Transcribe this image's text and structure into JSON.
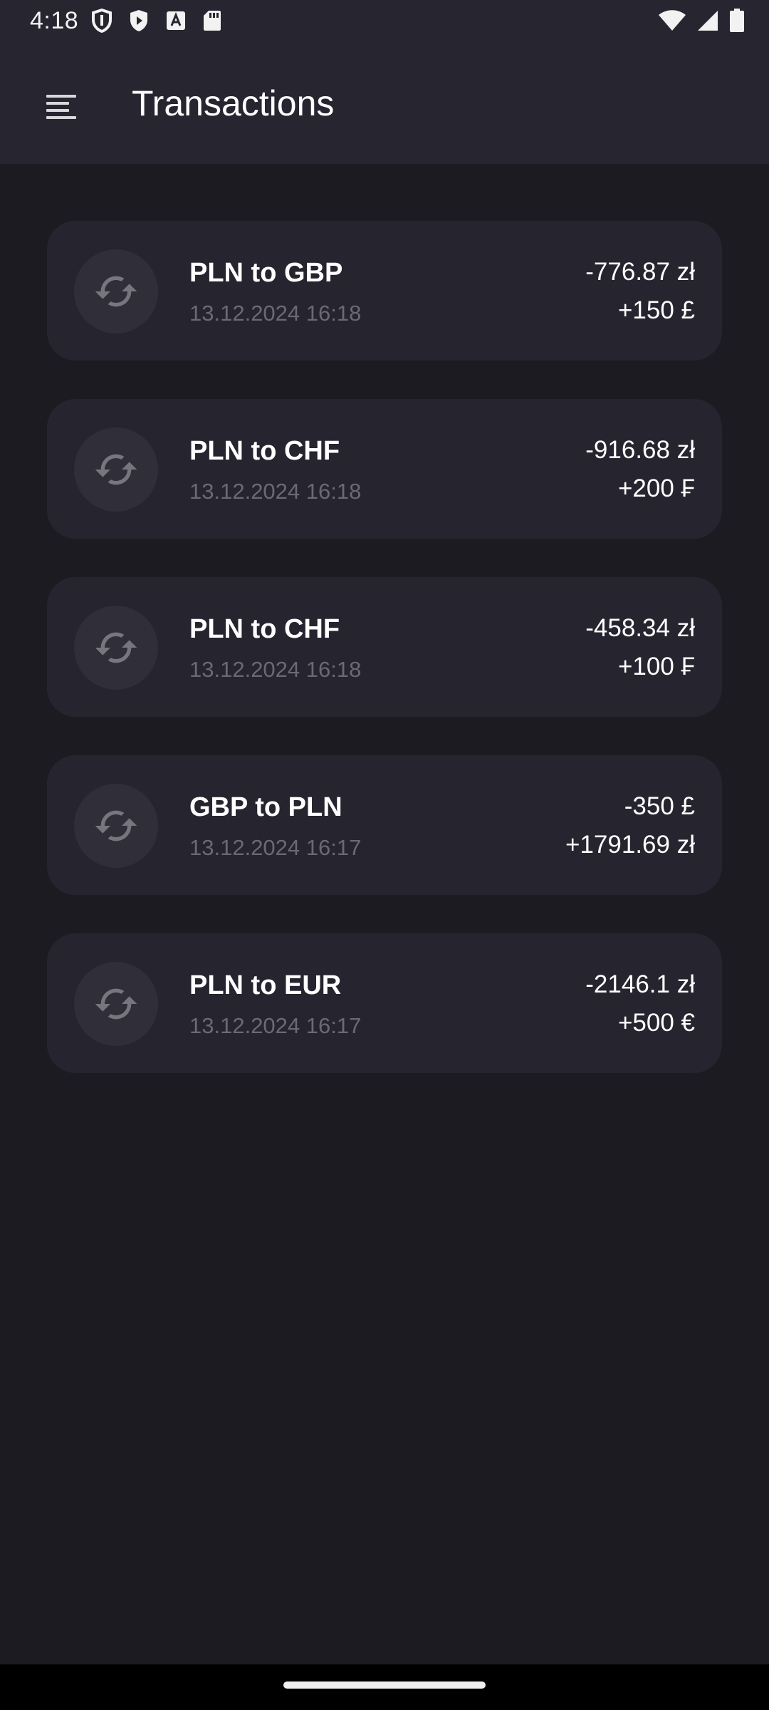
{
  "status_bar": {
    "time": "4:18",
    "left_icons": [
      "shield-icon",
      "play-protect-icon",
      "font-a-icon",
      "sd-card-icon"
    ],
    "right_icons": [
      "wifi-icon",
      "cellular-signal-icon",
      "battery-icon"
    ]
  },
  "app_bar": {
    "menu_icon": "menu-icon",
    "title": "Transactions"
  },
  "colors": {
    "background": "#1c1b21",
    "top_bar": "#262530",
    "card": "#26252f",
    "avatar": "#2f2e39",
    "date_text": "#6b6a74"
  },
  "transactions": [
    {
      "icon": "exchange-icon",
      "title": "PLN to GBP",
      "date": "13.12.2024 16:18",
      "debit": "-776.87 zł",
      "credit": "+150 £"
    },
    {
      "icon": "exchange-icon",
      "title": "PLN to CHF",
      "date": "13.12.2024 16:18",
      "debit": "-916.68 zł",
      "credit": "+200 ₣"
    },
    {
      "icon": "exchange-icon",
      "title": "PLN to CHF",
      "date": "13.12.2024 16:18",
      "debit": "-458.34 zł",
      "credit": "+100 ₣"
    },
    {
      "icon": "exchange-icon",
      "title": "GBP to PLN",
      "date": "13.12.2024 16:17",
      "debit": "-350 £",
      "credit": "+1791.69 zł"
    },
    {
      "icon": "exchange-icon",
      "title": "PLN to EUR",
      "date": "13.12.2024 16:17",
      "debit": "-2146.1 zł",
      "credit": "+500 €"
    }
  ]
}
